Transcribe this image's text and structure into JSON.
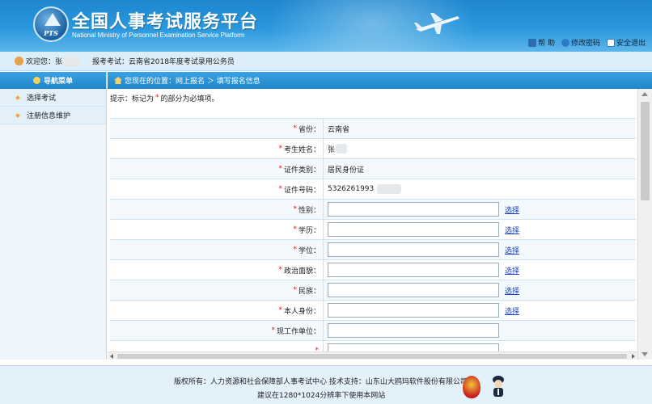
{
  "header": {
    "logo_text": "PTS",
    "title": "全国人事考试服务平台",
    "subtitle": "National Ministry of Personnel Examination Service Platform",
    "links": [
      {
        "icon": "help-icon",
        "label": "帮 助"
      },
      {
        "icon": "password-icon",
        "label": "修改密码"
      },
      {
        "icon": "exit-icon",
        "label": "安全退出"
      }
    ]
  },
  "welcome": {
    "greeting": "欢迎您：张",
    "exam": "报考考试：云南省2018年度考试录用公务员"
  },
  "sidebar": {
    "title": "导航菜单",
    "items": [
      {
        "label": "选择考试"
      },
      {
        "label": "注册信息维护"
      }
    ]
  },
  "breadcrumb": {
    "text": "您现在的位置：网上报名 ＞ 填写报名信息"
  },
  "tip": {
    "prefix": "提示：标记为",
    "star": "*",
    "suffix": "的部分为必填项。"
  },
  "form": {
    "star": "*",
    "select_label": "选择",
    "rows": [
      {
        "label": "省份：",
        "value": "云南省"
      },
      {
        "label": "考生姓名：",
        "value": "张"
      },
      {
        "label": "证件类别：",
        "value": "居民身份证"
      },
      {
        "label": "证件号码：",
        "value": "5326261993"
      },
      {
        "label": "性别：",
        "value": ""
      },
      {
        "label": "学历：",
        "value": ""
      },
      {
        "label": "学位：",
        "value": ""
      },
      {
        "label": "政治面貌：",
        "value": ""
      },
      {
        "label": "民族：",
        "value": ""
      },
      {
        "label": "本人身份：",
        "value": ""
      },
      {
        "label": "现工作单位：",
        "value": ""
      }
    ]
  },
  "footer": {
    "line1": "版权所有：人力资源和社会保障部人事考试中心 技术支持：山东山大鸥玛软件股份有限公司",
    "line2": "建议在1280*1024分辨率下使用本网站"
  },
  "colors": {
    "header_blue": "#1d86cf",
    "nav_blue": "#1f86cb",
    "required_red": "#e01010",
    "link_blue": "#1a3fb8"
  }
}
